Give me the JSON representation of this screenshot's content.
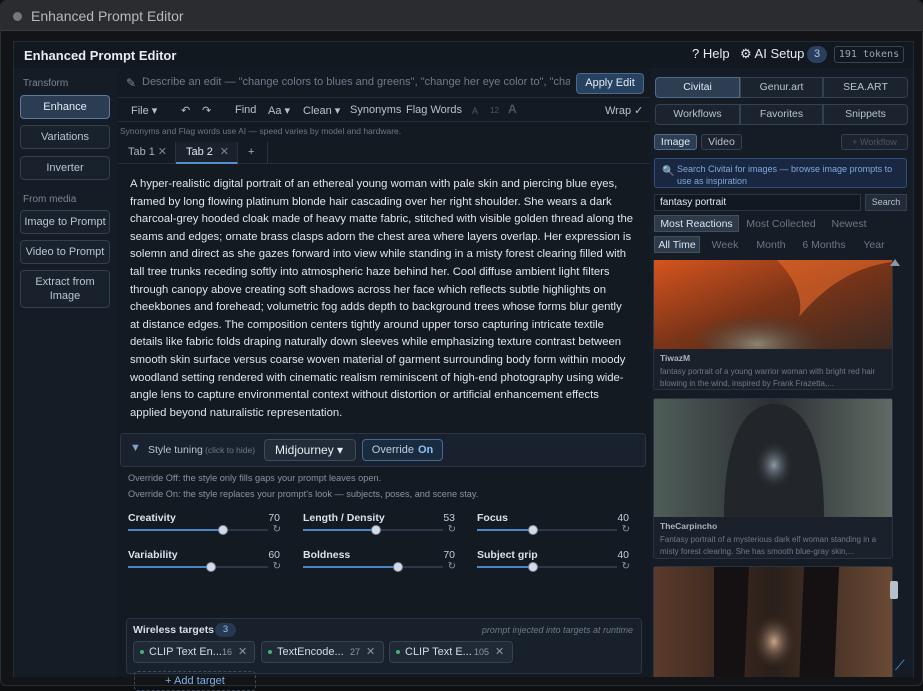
{
  "window": {
    "title": "Enhanced Prompt Editor"
  },
  "header": {
    "title": "Enhanced Prompt Editor",
    "help": "? Help",
    "ai_setup": "⚙ AI Setup",
    "count": "3",
    "tokens": "191 tokens"
  },
  "sidebar": {
    "transform_label": "Transform",
    "enhance": "Enhance",
    "variations": "Variations",
    "inverter": "Inverter",
    "media_label": "From media",
    "image_to_prompt": "Image to Prompt",
    "video_to_prompt": "Video to Prompt",
    "extract_line1": "Extract from",
    "extract_line2": "Image"
  },
  "command": {
    "placeholder": "Describe an edit — \"change colors to blues and greens\", \"change her eye color to\", \"change the lig",
    "apply": "Apply Edit"
  },
  "menu": {
    "file": "File ▾",
    "undo": "↶",
    "redo": "↷",
    "find": "Find",
    "font": "Aa ▾",
    "clean": "Clean ▾",
    "synonyms": "Synonyms",
    "flag": "Flag Words",
    "a_small": "A",
    "size": "12",
    "a_big": "A",
    "wrap": "Wrap ✓"
  },
  "hint": "Synonyms and Flag words use AI — speed varies by model and hardware.",
  "tabs": [
    {
      "label": "Tab 1"
    },
    {
      "label": "Tab 2"
    }
  ],
  "tab_close": "✕",
  "tab_add": "+",
  "prompt_text": "A hyper-realistic digital portrait of an ethereal young woman with pale skin and piercing blue eyes, framed by long flowing platinum blonde hair cascading over her right shoulder. She wears a dark charcoal-grey hooded cloak made of heavy matte fabric, stitched with visible golden thread along the seams and edges; ornate brass clasps adorn the chest area where layers overlap. Her expression is solemn and direct as she gazes forward into view while standing in a misty forest clearing filled with tall tree trunks receding softly into atmospheric haze behind her. Cool diffuse ambient light filters through canopy above creating soft shadows across her face which reflects subtle highlights on cheekbones and forehead; volumetric fog adds depth to background trees whose forms blur gently at distance edges. The composition centers tightly around upper torso capturing intricate textile details like fabric folds draping naturally down sleeves while emphasizing texture contrast between smooth skin surface versus coarse woven material of garment surrounding body form within moody woodland setting rendered with cinematic realism reminiscent of high-end photography using wide-angle lens to capture environmental context without distortion or artificial enhancement effects applied beyond naturalistic representation.",
  "style": {
    "label": "Style tuning",
    "hide": "(click to hide)",
    "selected": "Midjourney ▾",
    "override_label": "Override",
    "override_state": "On",
    "note_off": "Override Off: the style only fills gaps your prompt leaves open.",
    "note_on": "Override On: the style replaces your prompt's look — subjects, poses, and scene stay."
  },
  "sliders": [
    {
      "name": "Creativity",
      "value": 70,
      "level": 0.68
    },
    {
      "name": "Length / Density",
      "value": 53,
      "level": 0.52
    },
    {
      "name": "Focus",
      "value": 40,
      "level": 0.4
    },
    {
      "name": "Variability",
      "value": 60,
      "level": 0.59
    },
    {
      "name": "Boldness",
      "value": 70,
      "level": 0.68
    },
    {
      "name": "Subject grip",
      "value": 40,
      "level": 0.4
    }
  ],
  "reset_icon": "↻",
  "wireless": {
    "title": "Wireless targets",
    "count": "3",
    "note": "prompt injected into targets at runtime",
    "add": "+ Add target",
    "chips": [
      {
        "label": "CLIP Text En...",
        "n": "16"
      },
      {
        "label": "TextEncode...",
        "n": "27"
      },
      {
        "label": "CLIP Text E...",
        "n": "105"
      }
    ]
  },
  "chip_close": "✕",
  "right": {
    "sources": [
      "Civitai",
      "Genur.art",
      "SEA.ART"
    ],
    "views": [
      "Workflows",
      "Favorites",
      "Snippets"
    ],
    "media": [
      "Image",
      "Video"
    ],
    "workflow_btn": "+ Workflow",
    "search_hint": "Search Civitai for images — browse image prompts to use as inspiration",
    "search_value": "fantasy portrait",
    "search_btn": "Search",
    "sort": [
      "Most Reactions",
      "Most Collected",
      "Newest"
    ],
    "periods": [
      "All Time",
      "Week",
      "Month",
      "6 Months",
      "Year"
    ],
    "cards": [
      {
        "author": "TiwazM",
        "desc": "fantasy portrait of a young warrior woman with bright red hair blowing in the wind, inspired by Frank Frazetta,..."
      },
      {
        "author": "TheCarpincho",
        "desc": "Fantasy portrait of a mysterious dark elf woman standing in a misty forest clearing. She has smooth blue-gray skin,..."
      }
    ]
  },
  "colors": {
    "accent": "#4d86c6",
    "bg": "#151b24"
  }
}
